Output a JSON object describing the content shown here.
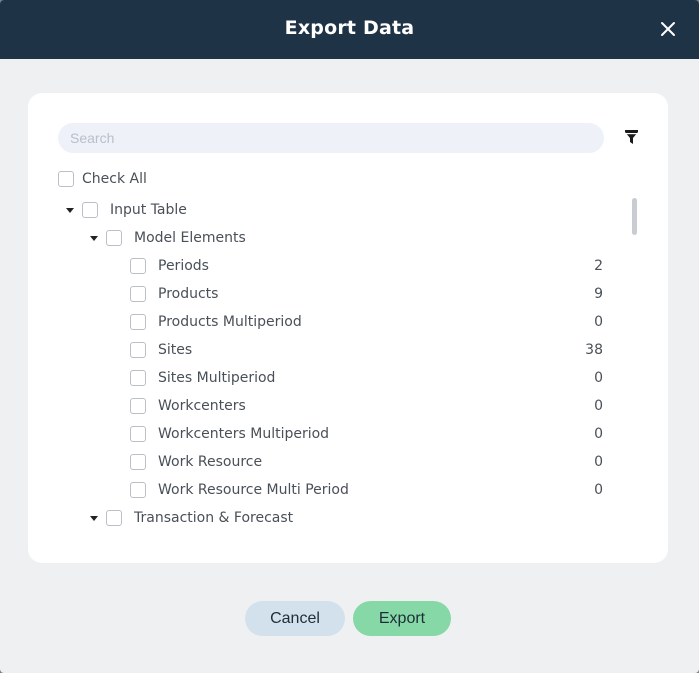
{
  "dialog": {
    "title": "Export Data",
    "close_icon": "close-icon"
  },
  "search": {
    "placeholder": "Search",
    "value": ""
  },
  "filter_icon": "filter-icon",
  "check_all_label": "Check All",
  "tree": {
    "input_table": {
      "label": "Input Table",
      "model_elements": {
        "label": "Model Elements",
        "items": [
          {
            "label": "Periods",
            "count": "2"
          },
          {
            "label": "Products",
            "count": "9"
          },
          {
            "label": "Products Multiperiod",
            "count": "0"
          },
          {
            "label": "Sites",
            "count": "38"
          },
          {
            "label": "Sites Multiperiod",
            "count": "0"
          },
          {
            "label": "Workcenters",
            "count": "0"
          },
          {
            "label": "Workcenters Multiperiod",
            "count": "0"
          },
          {
            "label": "Work Resource",
            "count": "0"
          },
          {
            "label": "Work Resource Multi Period",
            "count": "0"
          }
        ]
      },
      "transaction_forecast": {
        "label": "Transaction & Forecast"
      }
    }
  },
  "buttons": {
    "cancel": "Cancel",
    "export": "Export"
  },
  "colors": {
    "header_bg": "#1f3347",
    "cancel_bg": "#d3e1ec",
    "export_bg": "#86d9a6",
    "dialog_bg": "#eff0f2"
  }
}
